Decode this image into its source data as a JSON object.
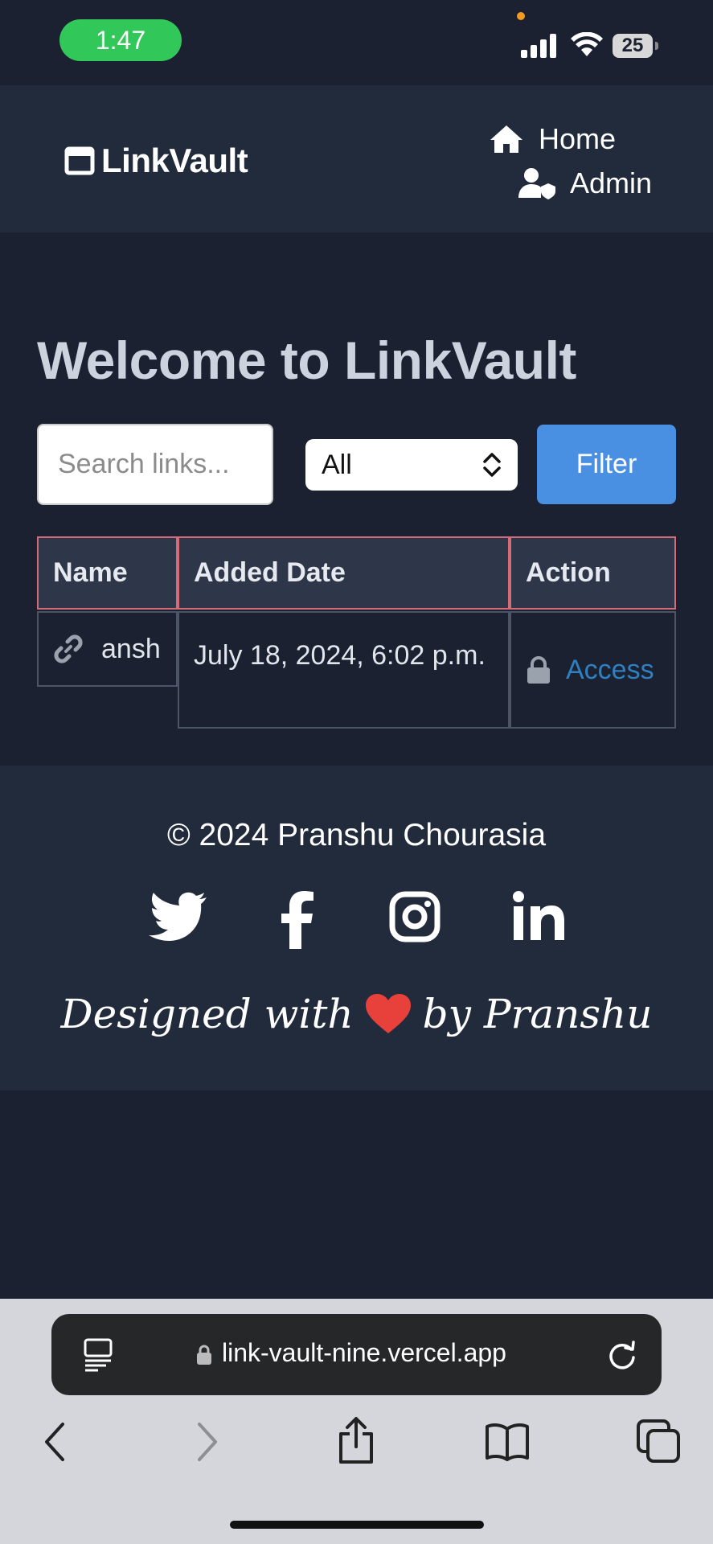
{
  "status": {
    "time": "1:47",
    "battery": "25"
  },
  "nav": {
    "brand": "LinkVault",
    "home": "Home",
    "admin": "Admin"
  },
  "main": {
    "title": "Welcome to LinkVault",
    "search_placeholder": "Search links...",
    "select_value": "All",
    "filter_label": "Filter"
  },
  "table": {
    "headers": [
      "Name",
      "Added Date",
      "Action"
    ],
    "rows": [
      {
        "name": "ansh",
        "date": "July 18, 2024, 6:02 p.m.",
        "action": "Access"
      }
    ]
  },
  "footer": {
    "copyright": "© 2024 Pranshu Chourasia",
    "designed_prefix": "Designed with",
    "designed_suffix": "by Pranshu",
    "social": [
      "twitter-icon",
      "facebook-icon",
      "instagram-icon",
      "linkedin-icon"
    ]
  },
  "browser": {
    "url": "link-vault-nine.vercel.app"
  },
  "colors": {
    "accent": "#4a90e2",
    "link": "#2f80c0",
    "heart": "#e8403a",
    "header_border": "#d46b78"
  }
}
